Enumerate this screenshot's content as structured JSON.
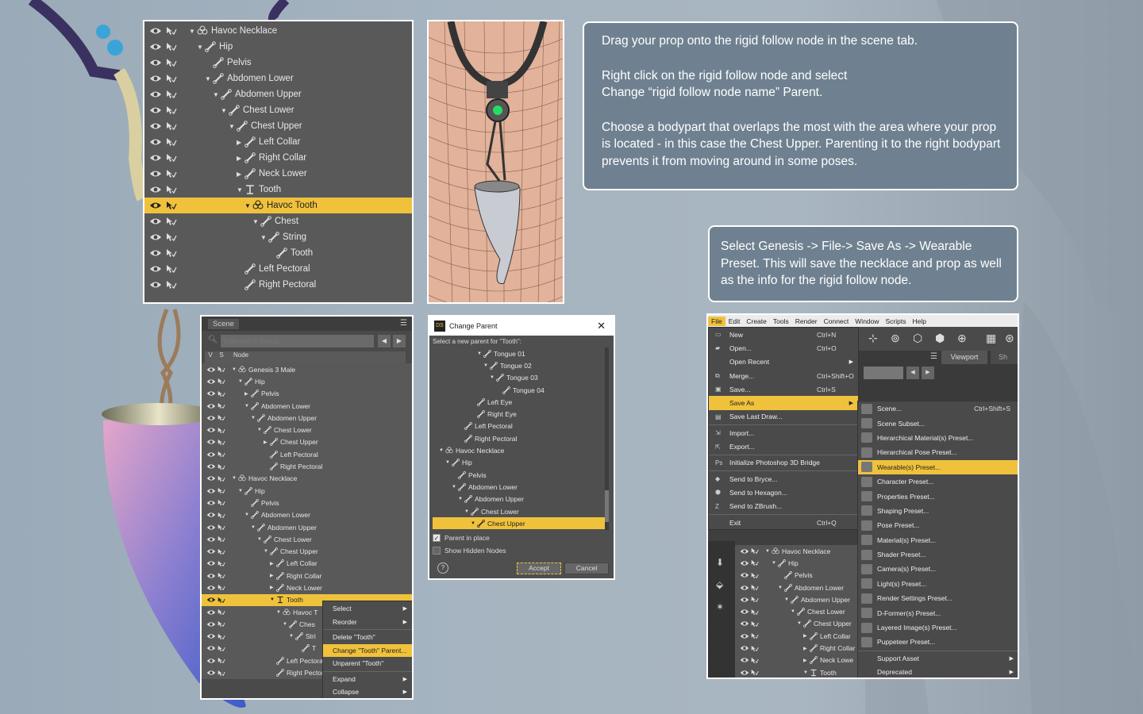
{
  "top_scene_tree": {
    "rows": [
      {
        "label": "Havoc Necklace",
        "icon": "figure-icon",
        "indent": 0,
        "tw": "▼",
        "sel": false
      },
      {
        "label": "Hip",
        "icon": "bone-icon",
        "indent": 1,
        "tw": "▼",
        "sel": false
      },
      {
        "label": "Pelvis",
        "icon": "bone-icon",
        "indent": 2,
        "tw": "",
        "sel": false
      },
      {
        "label": "Abdomen Lower",
        "icon": "bone-icon",
        "indent": 2,
        "tw": "▼",
        "sel": false
      },
      {
        "label": "Abdomen Upper",
        "icon": "bone-icon",
        "indent": 3,
        "tw": "▼",
        "sel": false
      },
      {
        "label": "Chest Lower",
        "icon": "bone-icon",
        "indent": 4,
        "tw": "▼",
        "sel": false
      },
      {
        "label": "Chest Upper",
        "icon": "bone-icon",
        "indent": 5,
        "tw": "▼",
        "sel": false
      },
      {
        "label": "Left Collar",
        "icon": "bone-icon",
        "indent": 6,
        "tw": "▶",
        "sel": false
      },
      {
        "label": "Right Collar",
        "icon": "bone-icon",
        "indent": 6,
        "tw": "▶",
        "sel": false
      },
      {
        "label": "Neck Lower",
        "icon": "bone-icon",
        "indent": 6,
        "tw": "▶",
        "sel": false
      },
      {
        "label": "Tooth",
        "icon": "rigid-follow-icon",
        "indent": 6,
        "tw": "▼",
        "sel": false
      },
      {
        "label": "Havoc Tooth",
        "icon": "figure-icon",
        "indent": 7,
        "tw": "▼",
        "sel": true
      },
      {
        "label": "Chest",
        "icon": "bone-icon",
        "indent": 8,
        "tw": "▼",
        "sel": false
      },
      {
        "label": "String",
        "icon": "bone-icon",
        "indent": 9,
        "tw": "▼",
        "sel": false
      },
      {
        "label": "Tooth",
        "icon": "bone-icon",
        "indent": 10,
        "tw": "",
        "sel": false
      },
      {
        "label": "Left Pectoral",
        "icon": "bone-icon",
        "indent": 6,
        "tw": "",
        "sel": false
      },
      {
        "label": "Right Pectoral",
        "icon": "bone-icon",
        "indent": 6,
        "tw": "",
        "sel": false
      }
    ]
  },
  "notes": {
    "note1_p1": "Drag your prop onto the rigid follow node in the scene tab.",
    "note1_p2a": "Right click on the rigid follow node and select",
    "note1_p2b": "Change “rigid follow node name” Parent.",
    "note1_p3": "Choose a bodypart  that overlaps the most with the area where your prop is located - in this case the Chest Upper. Parenting it to the right bodypart prevents it from moving around in some poses.",
    "note2": "Select Genesis -> File-> Save As -> Wearable Preset. This will save the necklace and prop as well as the info for the rigid follow node."
  },
  "scene_pane": {
    "tab": "Scene",
    "filter_placeholder": "Enter text to filter by...",
    "col_v": "V",
    "col_s": "S",
    "col_node": "Node",
    "rows": [
      {
        "label": "Genesis 3 Male",
        "icon": "figure-icon",
        "indent": 0,
        "tw": "▼",
        "sel": false
      },
      {
        "label": "Hip",
        "icon": "bone-icon",
        "indent": 1,
        "tw": "▼",
        "sel": false
      },
      {
        "label": "Pelvis",
        "icon": "bone-icon",
        "indent": 2,
        "tw": "▶",
        "sel": false
      },
      {
        "label": "Abdomen Lower",
        "icon": "bone-icon",
        "indent": 2,
        "tw": "▼",
        "sel": false
      },
      {
        "label": "Abdomen Upper",
        "icon": "bone-icon",
        "indent": 3,
        "tw": "▼",
        "sel": false
      },
      {
        "label": "Chest Lower",
        "icon": "bone-icon",
        "indent": 4,
        "tw": "▼",
        "sel": false
      },
      {
        "label": "Chest Upper",
        "icon": "bone-icon",
        "indent": 5,
        "tw": "▶",
        "sel": false
      },
      {
        "label": "Left Pectoral",
        "icon": "bone-icon",
        "indent": 5,
        "tw": "",
        "sel": false
      },
      {
        "label": "Right Pectoral",
        "icon": "bone-icon",
        "indent": 5,
        "tw": "",
        "sel": false
      },
      {
        "label": "Havoc Necklace",
        "icon": "figure-icon",
        "indent": 0,
        "tw": "▼",
        "sel": false
      },
      {
        "label": "Hip",
        "icon": "bone-icon",
        "indent": 1,
        "tw": "▼",
        "sel": false
      },
      {
        "label": "Pelvis",
        "icon": "bone-icon",
        "indent": 2,
        "tw": "",
        "sel": false
      },
      {
        "label": "Abdomen Lower",
        "icon": "bone-icon",
        "indent": 2,
        "tw": "▼",
        "sel": false
      },
      {
        "label": "Abdomen Upper",
        "icon": "bone-icon",
        "indent": 3,
        "tw": "▼",
        "sel": false
      },
      {
        "label": "Chest Lower",
        "icon": "bone-icon",
        "indent": 4,
        "tw": "▼",
        "sel": false
      },
      {
        "label": "Chest Upper",
        "icon": "bone-icon",
        "indent": 5,
        "tw": "▼",
        "sel": false
      },
      {
        "label": "Left Collar",
        "icon": "bone-icon",
        "indent": 6,
        "tw": "▶",
        "sel": false
      },
      {
        "label": "Right Collar",
        "icon": "bone-icon",
        "indent": 6,
        "tw": "▶",
        "sel": false
      },
      {
        "label": "Neck Lower",
        "icon": "bone-icon",
        "indent": 6,
        "tw": "▶",
        "sel": false
      },
      {
        "label": "Tooth",
        "icon": "rigid-follow-icon",
        "indent": 6,
        "tw": "▼",
        "sel": true
      },
      {
        "label": "Havoc T",
        "icon": "figure-icon",
        "indent": 7,
        "tw": "▼",
        "sel": false
      },
      {
        "label": "Ches",
        "icon": "bone-icon",
        "indent": 8,
        "tw": "▼",
        "sel": false
      },
      {
        "label": "Stri",
        "icon": "bone-icon",
        "indent": 9,
        "tw": "▼",
        "sel": false
      },
      {
        "label": "T",
        "icon": "bone-icon",
        "indent": 10,
        "tw": "",
        "sel": false
      },
      {
        "label": "Left Pectora",
        "icon": "bone-icon",
        "indent": 6,
        "tw": "",
        "sel": false
      },
      {
        "label": "Right Pectora",
        "icon": "bone-icon",
        "indent": 6,
        "tw": "",
        "sel": false
      }
    ],
    "context_menu": [
      {
        "label": "Select",
        "arrow": "▶",
        "sel": false
      },
      {
        "label": "Reorder",
        "arrow": "▶",
        "sel": false
      },
      {
        "label": "Delete \"Tooth\"",
        "arrow": "",
        "sel": false
      },
      {
        "label": "Change \"Tooth\" Parent...",
        "arrow": "",
        "sel": true
      },
      {
        "label": "Unparent \"Tooth\"",
        "arrow": "",
        "sel": false
      },
      {
        "label": "Expand",
        "arrow": "▶",
        "sel": false
      },
      {
        "label": "Collapse",
        "arrow": "▶",
        "sel": false
      }
    ]
  },
  "change_parent": {
    "title": "Change Parent",
    "logo": "DS",
    "prompt": "Select a new parent for \"Tooth\":",
    "rows": [
      {
        "label": "Tongue 01",
        "icon": "bone-icon",
        "indent": 6,
        "tw": "▼",
        "sel": false
      },
      {
        "label": "Tongue 02",
        "icon": "bone-icon",
        "indent": 7,
        "tw": "▼",
        "sel": false
      },
      {
        "label": "Tongue 03",
        "icon": "bone-icon",
        "indent": 8,
        "tw": "▼",
        "sel": false
      },
      {
        "label": "Tongue 04",
        "icon": "bone-icon",
        "indent": 9,
        "tw": "",
        "sel": false
      },
      {
        "label": "Left Eye",
        "icon": "bone-icon",
        "indent": 5,
        "tw": "",
        "sel": false
      },
      {
        "label": "Right Eye",
        "icon": "bone-icon",
        "indent": 5,
        "tw": "",
        "sel": false
      },
      {
        "label": "Left Pectoral",
        "icon": "bone-icon",
        "indent": 3,
        "tw": "",
        "sel": false
      },
      {
        "label": "Right Pectoral",
        "icon": "bone-icon",
        "indent": 3,
        "tw": "",
        "sel": false
      },
      {
        "label": "Havoc Necklace",
        "icon": "figure-icon",
        "indent": 0,
        "tw": "▼",
        "sel": false
      },
      {
        "label": "Hip",
        "icon": "bone-icon",
        "indent": 1,
        "tw": "▼",
        "sel": false
      },
      {
        "label": "Pelvis",
        "icon": "bone-icon",
        "indent": 2,
        "tw": "",
        "sel": false
      },
      {
        "label": "Abdomen Lower",
        "icon": "bone-icon",
        "indent": 2,
        "tw": "▼",
        "sel": false
      },
      {
        "label": "Abdomen Upper",
        "icon": "bone-icon",
        "indent": 3,
        "tw": "▼",
        "sel": false
      },
      {
        "label": "Chest Lower",
        "icon": "bone-icon",
        "indent": 4,
        "tw": "▼",
        "sel": false
      },
      {
        "label": "Chest Upper",
        "icon": "bone-icon",
        "indent": 5,
        "tw": "▼",
        "sel": true
      }
    ],
    "parent_in_place": "Parent in place",
    "show_hidden": "Show Hidden Nodes",
    "accept": "Accept",
    "cancel": "Cancel",
    "help": "?"
  },
  "daz": {
    "menubar": [
      "File",
      "Edit",
      "Create",
      "Tools",
      "Render",
      "Connect",
      "Window",
      "Scripts",
      "Help"
    ],
    "viewport_tab": "Viewport",
    "sh_tab": "Sh",
    "file_menu": [
      {
        "label": "New",
        "shortcut": "Ctrl+N",
        "arrow": "",
        "sel": false,
        "icon": "new-file-icon",
        "sep": false
      },
      {
        "label": "Open...",
        "shortcut": "Ctrl+O",
        "arrow": "",
        "sel": false,
        "icon": "open-folder-icon",
        "sep": false
      },
      {
        "label": "Open Recent",
        "shortcut": "",
        "arrow": "▶",
        "sel": false,
        "icon": "",
        "sep": false
      },
      {
        "label": "Merge...",
        "shortcut": "Ctrl+Shift+O",
        "arrow": "",
        "sel": false,
        "icon": "merge-icon",
        "sep": false
      },
      {
        "label": "Save...",
        "shortcut": "Ctrl+S",
        "arrow": "",
        "sel": false,
        "icon": "save-icon",
        "sep": false
      },
      {
        "label": "Save As",
        "shortcut": "",
        "arrow": "▶",
        "sel": true,
        "icon": "",
        "sep": false
      },
      {
        "label": "Save Last Draw...",
        "shortcut": "",
        "arrow": "",
        "sel": false,
        "icon": "save-draw-icon",
        "sep": true
      },
      {
        "label": "Import...",
        "shortcut": "",
        "arrow": "",
        "sel": false,
        "icon": "import-icon",
        "sep": false
      },
      {
        "label": "Export...",
        "shortcut": "",
        "arrow": "",
        "sel": false,
        "icon": "export-icon",
        "sep": true
      },
      {
        "label": "Initialize Photoshop 3D Bridge",
        "shortcut": "",
        "arrow": "",
        "sel": false,
        "icon": "photoshop-icon",
        "sep": true
      },
      {
        "label": "Send to Bryce...",
        "shortcut": "",
        "arrow": "",
        "sel": false,
        "icon": "bryce-icon",
        "sep": false
      },
      {
        "label": "Send to Hexagon...",
        "shortcut": "",
        "arrow": "",
        "sel": false,
        "icon": "hexagon-icon",
        "sep": false
      },
      {
        "label": "Send to ZBrush...",
        "shortcut": "",
        "arrow": "",
        "sel": false,
        "icon": "zbrush-icon",
        "sep": true
      },
      {
        "label": "Exit",
        "shortcut": "Ctrl+Q",
        "arrow": "",
        "sel": false,
        "icon": "",
        "sep": false
      }
    ],
    "saveas_menu": [
      {
        "label": "Scene...",
        "shortcut": "Ctrl+Shift+S",
        "sel": false
      },
      {
        "label": "Scene Subset...",
        "shortcut": "",
        "sel": false
      },
      {
        "label": "Hierarchical Material(s) Preset...",
        "shortcut": "",
        "sel": false
      },
      {
        "label": "Hierarchical Pose Preset...",
        "shortcut": "",
        "sel": false
      },
      {
        "label": "Wearable(s) Preset...",
        "shortcut": "",
        "sel": true
      },
      {
        "label": "Character Preset...",
        "shortcut": "",
        "sel": false
      },
      {
        "label": "Properties Preset...",
        "shortcut": "",
        "sel": false
      },
      {
        "label": "Shaping Preset...",
        "shortcut": "",
        "sel": false
      },
      {
        "label": "Pose Preset...",
        "shortcut": "",
        "sel": false
      },
      {
        "label": "Material(s) Preset...",
        "shortcut": "",
        "sel": false
      },
      {
        "label": "Shader Preset...",
        "shortcut": "",
        "sel": false
      },
      {
        "label": "Camera(s) Preset...",
        "shortcut": "",
        "sel": false
      },
      {
        "label": "Light(s) Preset...",
        "shortcut": "",
        "sel": false
      },
      {
        "label": "Render Settings Preset...",
        "shortcut": "",
        "sel": false
      },
      {
        "label": "D-Former(s) Preset...",
        "shortcut": "",
        "sel": false
      },
      {
        "label": "Layered Image(s) Preset...",
        "shortcut": "",
        "sel": false
      },
      {
        "label": "Puppeteer Preset...",
        "shortcut": "",
        "sel": false
      }
    ],
    "saveas_bottom": [
      {
        "label": "Support Asset",
        "arrow": "▶"
      },
      {
        "label": "Deprecated",
        "arrow": "▶"
      }
    ],
    "tree_rows": [
      {
        "label": "Havoc Necklace",
        "icon": "figure-icon",
        "indent": 0,
        "tw": "▼"
      },
      {
        "label": "Hip",
        "icon": "bone-icon",
        "indent": 1,
        "tw": "▼"
      },
      {
        "label": "Pelvis",
        "icon": "bone-icon",
        "indent": 2,
        "tw": ""
      },
      {
        "label": "Abdomen Lower",
        "icon": "bone-icon",
        "indent": 2,
        "tw": "▼"
      },
      {
        "label": "Abdomen Upper",
        "icon": "bone-icon",
        "indent": 3,
        "tw": "▼"
      },
      {
        "label": "Chest Lower",
        "icon": "bone-icon",
        "indent": 4,
        "tw": "▼"
      },
      {
        "label": "Chest Upper",
        "icon": "bone-icon",
        "indent": 5,
        "tw": "▼"
      },
      {
        "label": "Left Collar",
        "icon": "bone-icon",
        "indent": 6,
        "tw": "▶"
      },
      {
        "label": "Right Collar",
        "icon": "bone-icon",
        "indent": 6,
        "tw": "▶"
      },
      {
        "label": "Neck Lowe",
        "icon": "bone-icon",
        "indent": 6,
        "tw": "▶"
      },
      {
        "label": "Tooth",
        "icon": "rigid-follow-icon",
        "indent": 6,
        "tw": "▼"
      }
    ]
  },
  "colors": {
    "highlight": "#f0c23c",
    "panel": "#595959",
    "note_bg": "#6f8190"
  }
}
